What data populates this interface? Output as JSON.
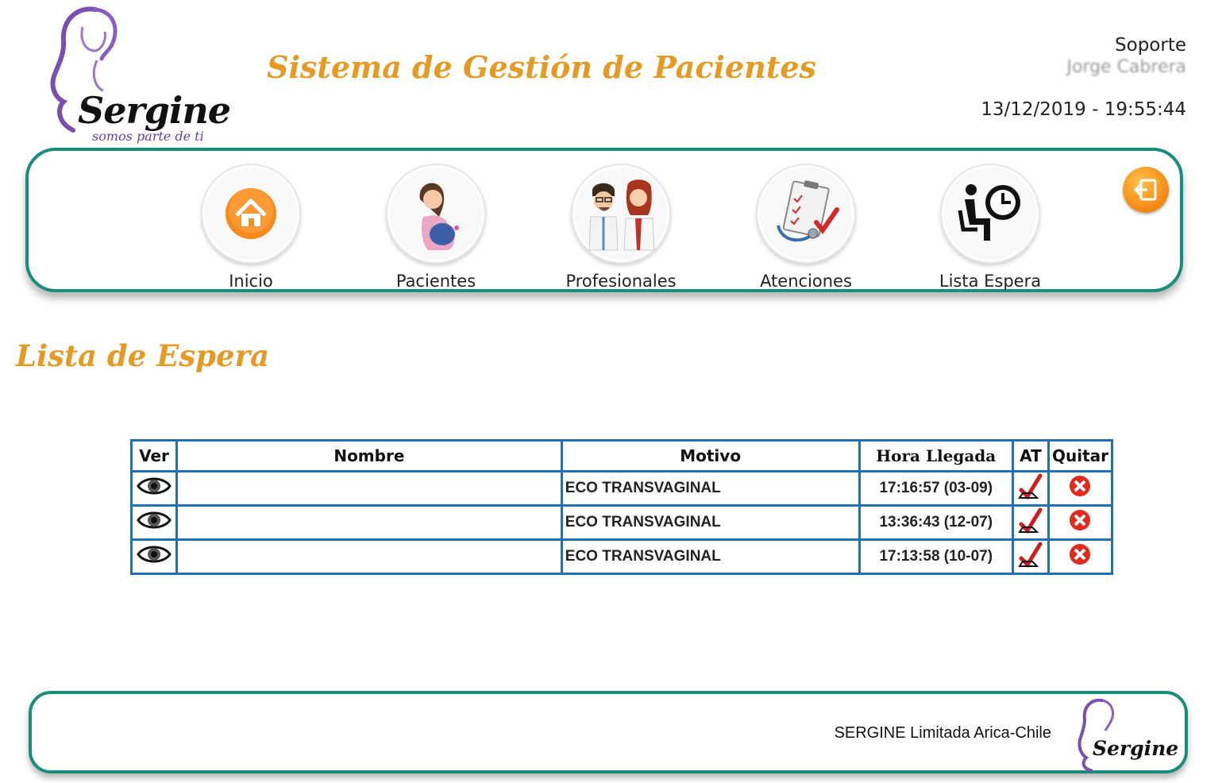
{
  "brand": {
    "name": "Sergine",
    "tagline": "somos parte de ti"
  },
  "app_title": "Sistema de Gestión de Pacientes",
  "user": {
    "role": "Soporte",
    "name": "Jorge Cabrera",
    "datetime": "13/12/2019 - 19:55:44"
  },
  "nav": {
    "items": [
      {
        "label": "Inicio",
        "icon": "home-icon"
      },
      {
        "label": "Pacientes",
        "icon": "pregnant-woman-icon"
      },
      {
        "label": "Profesionales",
        "icon": "doctors-icon"
      },
      {
        "label": "Atenciones",
        "icon": "clipboard-stethoscope-icon"
      },
      {
        "label": "Lista Espera",
        "icon": "waiting-clock-icon"
      }
    ],
    "logout_icon": "logout-icon"
  },
  "section_title": "Lista de Espera",
  "table": {
    "headers": {
      "ver": "Ver",
      "nombre": "Nombre",
      "motivo": "Motivo",
      "hora": "Hora Llegada",
      "at": "AT",
      "quitar": "Quitar"
    },
    "rows": [
      {
        "nombre": "",
        "motivo": "ECO TRANSVAGINAL",
        "hora": "17:16:57 (03-09)"
      },
      {
        "nombre": "",
        "motivo": "ECO TRANSVAGINAL",
        "hora": "13:36:43 (12-07)"
      },
      {
        "nombre": "",
        "motivo": "ECO TRANSVAGINAL",
        "hora": "17:13:58 (10-07)"
      }
    ]
  },
  "footer": {
    "text": "SERGINE Limitada Arica-Chile"
  },
  "colors": {
    "accent": "#e59a25",
    "border": "#1a8c7e",
    "table_border": "#1f6fb9",
    "brand_purple": "#6a3fa0"
  }
}
